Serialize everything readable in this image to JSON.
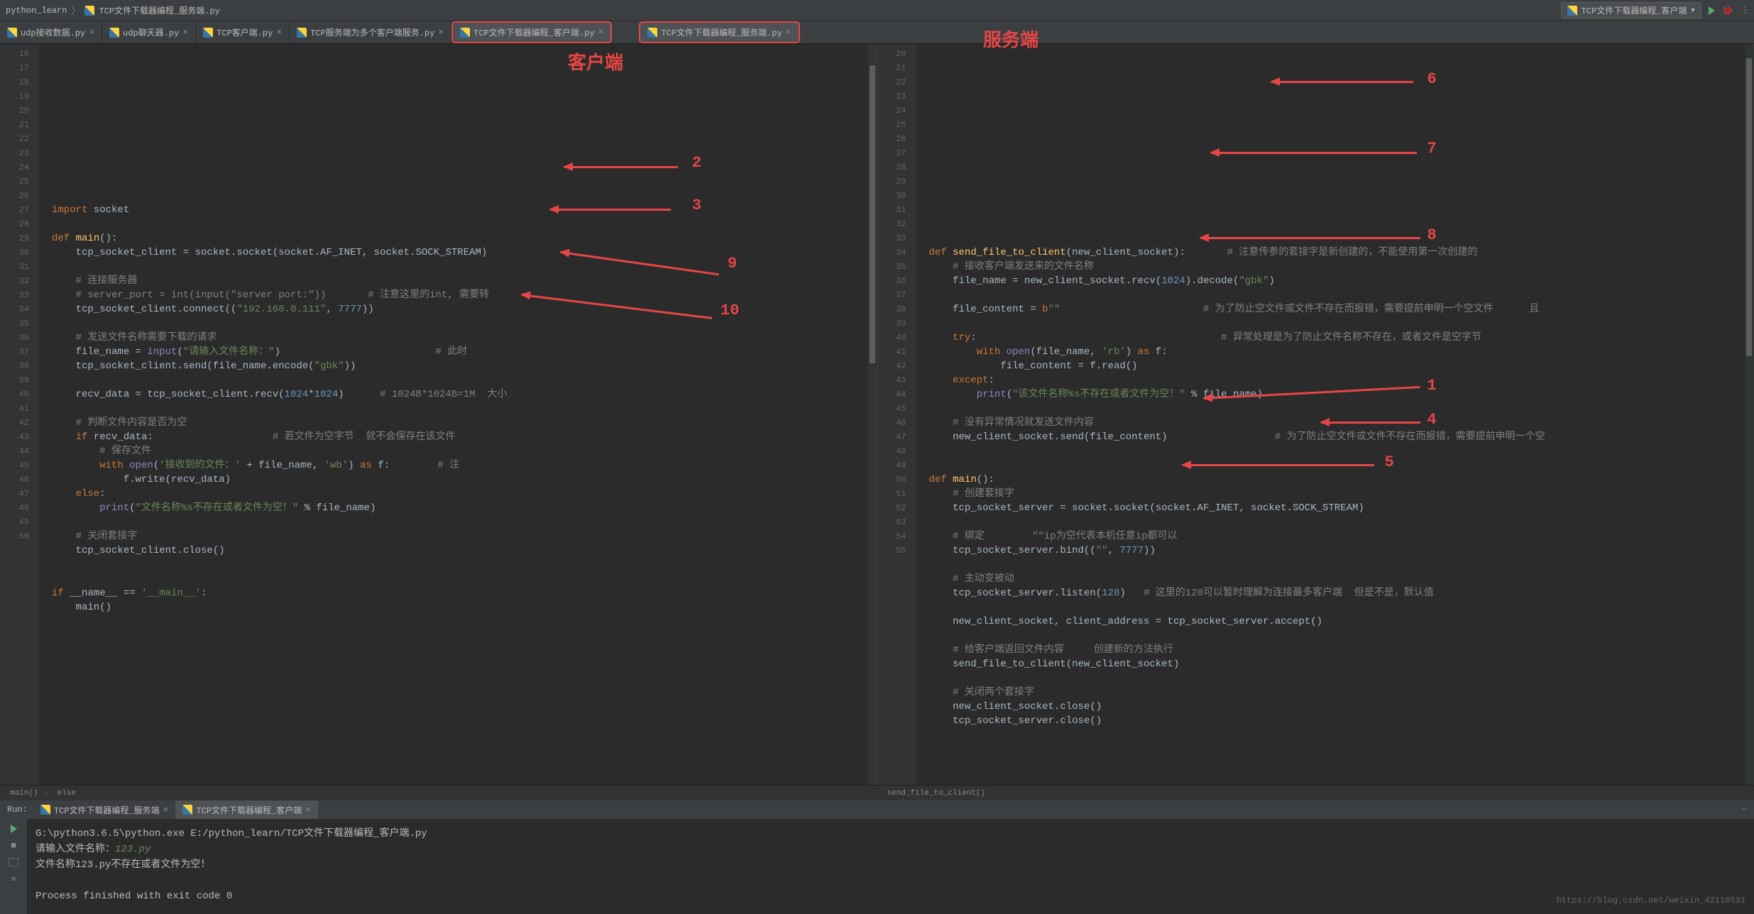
{
  "breadcrumb": {
    "project": "python_learn",
    "file": "TCP文件下载器编程_服务端.py"
  },
  "top_dropdown": "TCP文件下载器编程_客户端",
  "tabs_left": [
    {
      "label": "udp接收数据.py"
    },
    {
      "label": "udp聊天器.py"
    },
    {
      "label": "TCP客户端.py"
    },
    {
      "label": "TCP服务端为多个客户端服务.py"
    },
    {
      "label": "TCP文件下载器编程_客户端.py",
      "highlight": true
    }
  ],
  "tabs_right": [
    {
      "label": "TCP文件下载器编程_服务端.py",
      "highlight": true
    }
  ],
  "annotation_client": "客户端",
  "annotation_server": "服务端",
  "left_editor": {
    "start": 16,
    "lines": [
      [
        {
          "t": "import",
          "c": "kw"
        },
        {
          "t": " socket"
        }
      ],
      [],
      [
        {
          "t": "def ",
          "c": "kw"
        },
        {
          "t": "main",
          "c": "fn"
        },
        {
          "t": "():"
        }
      ],
      [
        {
          "t": "    tcp_socket_client = socket.socket(socket.AF_INET, socket.SOCK_STREAM)"
        }
      ],
      [],
      [
        {
          "t": "    # 连接服务器",
          "c": "cmt"
        }
      ],
      [
        {
          "t": "    # server_port = int(input(\"server port:\"))",
          "c": "cmt"
        },
        {
          "t": "       # 注意这里的int, 需要转",
          "c": "cmt"
        }
      ],
      [
        {
          "t": "    tcp_socket_client.connect(("
        },
        {
          "t": "\"192.168.0.111\"",
          "c": "str"
        },
        {
          "t": ", "
        },
        {
          "t": "7777",
          "c": "num"
        },
        {
          "t": "))"
        }
      ],
      [],
      [
        {
          "t": "    # 发送文件名称需要下载的请求",
          "c": "cmt"
        }
      ],
      [
        {
          "t": "    file_name = "
        },
        {
          "t": "input",
          "c": "bi"
        },
        {
          "t": "("
        },
        {
          "t": "\"请输入文件名称：\"",
          "c": "str"
        },
        {
          "t": ")"
        },
        {
          "t": "                          # 此时",
          "c": "cmt"
        }
      ],
      [
        {
          "t": "    tcp_socket_client.send(file_name.encode("
        },
        {
          "t": "\"gbk\"",
          "c": "str"
        },
        {
          "t": "))"
        }
      ],
      [],
      [
        {
          "t": "    recv_data = tcp_socket_client.recv("
        },
        {
          "t": "1024",
          "c": "num"
        },
        {
          "t": "*"
        },
        {
          "t": "1024",
          "c": "num"
        },
        {
          "t": ")"
        },
        {
          "t": "      # 1024B*1024B=1M  大小",
          "c": "cmt"
        }
      ],
      [],
      [
        {
          "t": "    # 判断文件内容是否为空",
          "c": "cmt"
        }
      ],
      [
        {
          "t": "    if ",
          "c": "kw"
        },
        {
          "t": "recv_data:"
        },
        {
          "t": "                    # 若文件为空字节  就不会保存在该文件",
          "c": "cmt"
        }
      ],
      [
        {
          "t": "        # 保存文件",
          "c": "cmt"
        }
      ],
      [
        {
          "t": "        with ",
          "c": "kw"
        },
        {
          "t": "open",
          "c": "bi"
        },
        {
          "t": "("
        },
        {
          "t": "'接收到的文件：'",
          "c": "str"
        },
        {
          "t": " + file_name, "
        },
        {
          "t": "'wb'",
          "c": "str"
        },
        {
          "t": ") "
        },
        {
          "t": "as ",
          "c": "kw"
        },
        {
          "t": "f:"
        },
        {
          "t": "        # 注",
          "c": "cmt"
        }
      ],
      [
        {
          "t": "            f.write(recv_data)"
        }
      ],
      [
        {
          "t": "    else",
          "c": "kw"
        },
        {
          "t": ":"
        }
      ],
      [
        {
          "t": "        "
        },
        {
          "t": "print",
          "c": "bi"
        },
        {
          "t": "("
        },
        {
          "t": "\"文件名称%s不存在或者文件为空！\"",
          "c": "str"
        },
        {
          "t": " % file_name)"
        }
      ],
      [],
      [
        {
          "t": "    # 关闭套接字",
          "c": "cmt"
        }
      ],
      [
        {
          "t": "    tcp_socket_client.close()"
        }
      ],
      [],
      [],
      [
        {
          "t": "if ",
          "c": "kw"
        },
        {
          "t": "__name__ == "
        },
        {
          "t": "'__main__'",
          "c": "str"
        },
        {
          "t": ":"
        }
      ],
      [
        {
          "t": "    main()"
        }
      ],
      [],
      [],
      [],
      [],
      [],
      []
    ],
    "crumbs": [
      "main()",
      "else"
    ]
  },
  "right_editor": {
    "start": 20,
    "lines": [
      [
        {
          "t": "def ",
          "c": "kw"
        },
        {
          "t": "send_file_to_client",
          "c": "fn"
        },
        {
          "t": "(new_client_socket):"
        },
        {
          "t": "       # 注意传参的套接字是新创建的，不能使用第一次创建的",
          "c": "cmt"
        }
      ],
      [
        {
          "t": "    # 接收客户端发送来的文件名称",
          "c": "cmt"
        }
      ],
      [
        {
          "t": "    file_name = new_client_socket.recv("
        },
        {
          "t": "1024",
          "c": "num"
        },
        {
          "t": ").decode("
        },
        {
          "t": "\"gbk\"",
          "c": "str"
        },
        {
          "t": ")"
        }
      ],
      [],
      [
        {
          "t": "    file_content = "
        },
        {
          "t": "b",
          "c": "kw"
        },
        {
          "t": "\"\"",
          "c": "str"
        },
        {
          "t": "                        # 为了防止空文件或文件不存在而报错，需要提前申明一个空文件      且",
          "c": "cmt"
        }
      ],
      [],
      [
        {
          "t": "    try",
          "c": "kw"
        },
        {
          "t": ":"
        },
        {
          "t": "                                         # 异常处理是为了防止文件名称不存在，或者文件是空字节",
          "c": "cmt"
        }
      ],
      [
        {
          "t": "        with ",
          "c": "kw"
        },
        {
          "t": "open",
          "c": "bi"
        },
        {
          "t": "(file_name, "
        },
        {
          "t": "'rb'",
          "c": "str"
        },
        {
          "t": ") "
        },
        {
          "t": "as ",
          "c": "kw"
        },
        {
          "t": "f:"
        }
      ],
      [
        {
          "t": "            file_content = f.read()"
        }
      ],
      [
        {
          "t": "    except",
          "c": "kw"
        },
        {
          "t": ":"
        }
      ],
      [
        {
          "t": "        "
        },
        {
          "t": "print",
          "c": "bi"
        },
        {
          "t": "("
        },
        {
          "t": "\"该文件名称%s不存在或者文件为空！\"",
          "c": "str"
        },
        {
          "t": " % file_name)"
        }
      ],
      [],
      [
        {
          "t": "    # 没有异常情况就发送文件内容",
          "c": "cmt"
        }
      ],
      [
        {
          "t": "    new_client_socket.send(file_content)"
        },
        {
          "t": "                  # 为了防止空文件或文件不存在而报错，需要提前申明一个空",
          "c": "cmt"
        }
      ],
      [],
      [],
      [
        {
          "t": "def ",
          "c": "kw"
        },
        {
          "t": "main",
          "c": "fn"
        },
        {
          "t": "():"
        }
      ],
      [
        {
          "t": "    # 创建套接字",
          "c": "cmt"
        }
      ],
      [
        {
          "t": "    tcp_socket_server = socket.socket(socket.AF_INET, socket.SOCK_STREAM)"
        }
      ],
      [],
      [
        {
          "t": "    # 绑定        \"\"ip为空代表本机任意ip都可以",
          "c": "cmt"
        }
      ],
      [
        {
          "t": "    tcp_socket_server.bind(("
        },
        {
          "t": "\"\"",
          "c": "str"
        },
        {
          "t": ", "
        },
        {
          "t": "7777",
          "c": "num"
        },
        {
          "t": "))"
        }
      ],
      [],
      [
        {
          "t": "    # 主动变被动",
          "c": "cmt"
        }
      ],
      [
        {
          "t": "    tcp_socket_server.listen("
        },
        {
          "t": "128",
          "c": "num"
        },
        {
          "t": ")"
        },
        {
          "t": "   # 这里的128可以暂时理解为连接最多客户端  但是不是，默认值",
          "c": "cmt"
        }
      ],
      [],
      [
        {
          "t": "    new_client_socket, client_address = tcp_socket_server.accept()"
        }
      ],
      [],
      [
        {
          "t": "    # 给客户端返回文件内容     创建新的方法执行",
          "c": "cmt"
        }
      ],
      [
        {
          "t": "    send_file_to_client(new_client_socket)"
        }
      ],
      [],
      [
        {
          "t": "    # 关闭两个套接字",
          "c": "cmt"
        }
      ],
      [
        {
          "t": "    new_client_socket.close()"
        }
      ],
      [
        {
          "t": "    tcp_socket_server.close()"
        }
      ],
      [],
      []
    ],
    "crumbs": [
      "send_file_to_client()"
    ]
  },
  "nums": {
    "n1": "1",
    "n2": "2",
    "n3": "3",
    "n4": "4",
    "n5": "5",
    "n6": "6",
    "n7": "7",
    "n8": "8",
    "n9": "9",
    "n10": "10"
  },
  "run": {
    "title": "Run:",
    "tabs": [
      "TCP文件下载器编程_服务端",
      "TCP文件下载器编程_客户端"
    ],
    "line1": "G:\\python3.6.5\\python.exe E:/python_learn/TCP文件下载器编程_客户端.py",
    "line2_prefix": "请输入文件名称：",
    "line2_input": "123.py",
    "line3": "文件名称123.py不存在或者文件为空！",
    "line5": "Process finished with exit code 0"
  },
  "watermark": "https://blog.csdn.net/weixin_42118531"
}
